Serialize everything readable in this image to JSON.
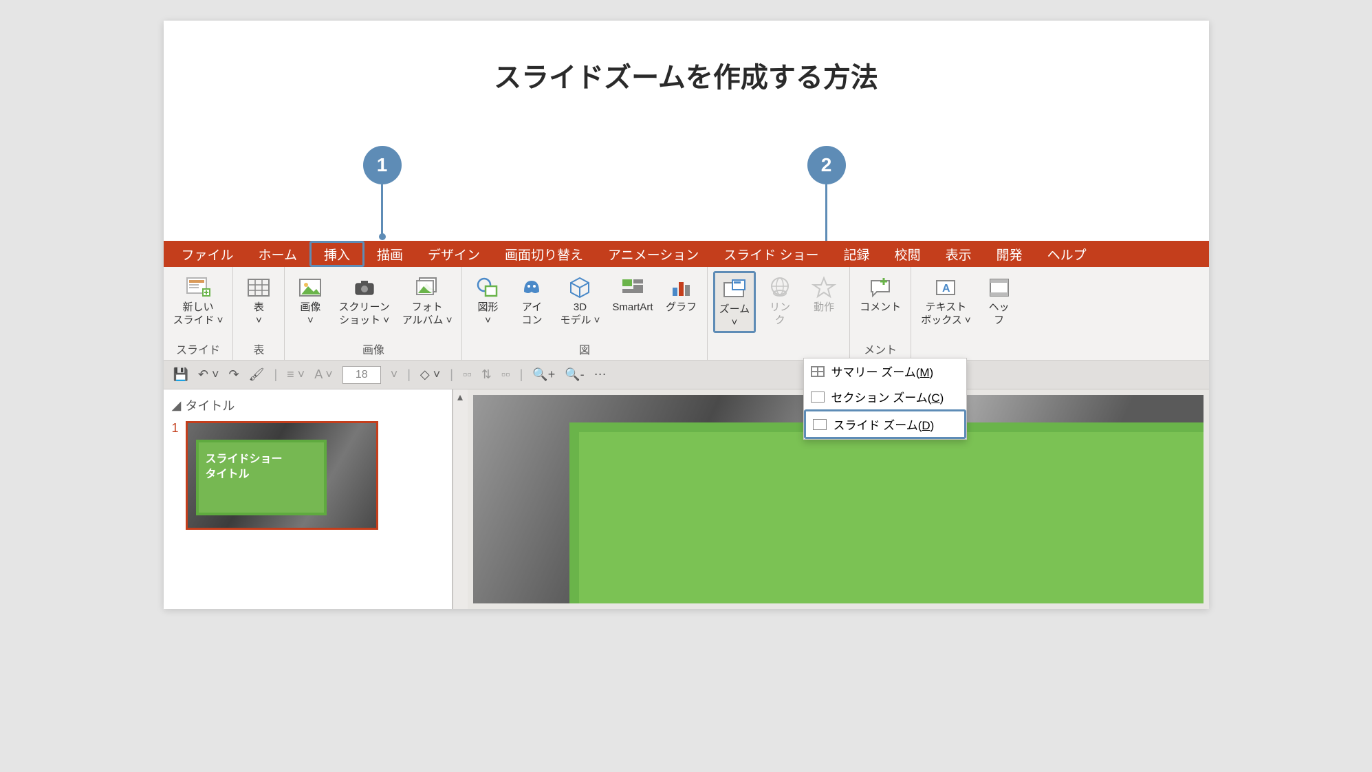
{
  "title": "スライドズームを作成する方法",
  "callouts": {
    "one": "1",
    "two": "2"
  },
  "ribbon_tabs": {
    "file": "ファイル",
    "home": "ホーム",
    "insert": "挿入",
    "draw": "描画",
    "design": "デザイン",
    "transitions": "画面切り替え",
    "animations": "アニメーション",
    "slideshow": "スライド ショー",
    "record": "記録",
    "review": "校閲",
    "view": "表示",
    "developer": "開発",
    "help": "ヘルプ"
  },
  "ribbon": {
    "slides": {
      "new_slide": "新しい\nスライド ˅",
      "group": "スライド"
    },
    "tables": {
      "table": "表\n˅",
      "group": "表"
    },
    "images": {
      "pictures": "画像\n˅",
      "screenshot": "スクリーン\nショット ˅",
      "album": "フォト\nアルバム ˅",
      "group": "画像"
    },
    "illustrations": {
      "shapes": "図形\n˅",
      "icons": "アイ\nコン",
      "models": "3D\nモデル ˅",
      "smartart": "SmartArt",
      "chart": "グラフ",
      "group": "図"
    },
    "links": {
      "zoom": "ズーム\n˅",
      "link": "リン\nク",
      "action": "動作"
    },
    "comments": {
      "comment": "コメント",
      "group": "メント"
    },
    "text": {
      "textbox": "テキスト\nボックス ˅",
      "headerfooter": "ヘッ\nフ"
    }
  },
  "zoom_menu": {
    "summary": "サマリー ズーム(",
    "summary_key": "M",
    "section": "セクション ズーム(",
    "section_key": "C",
    "slide": "スライド ズーム(",
    "slide_key": "D",
    "close": ")"
  },
  "qat": {
    "fontsize": "18"
  },
  "thumb_pane": {
    "section": "タイトル",
    "slide_number": "1",
    "slide_title": "スライドショー\nタイトル"
  }
}
